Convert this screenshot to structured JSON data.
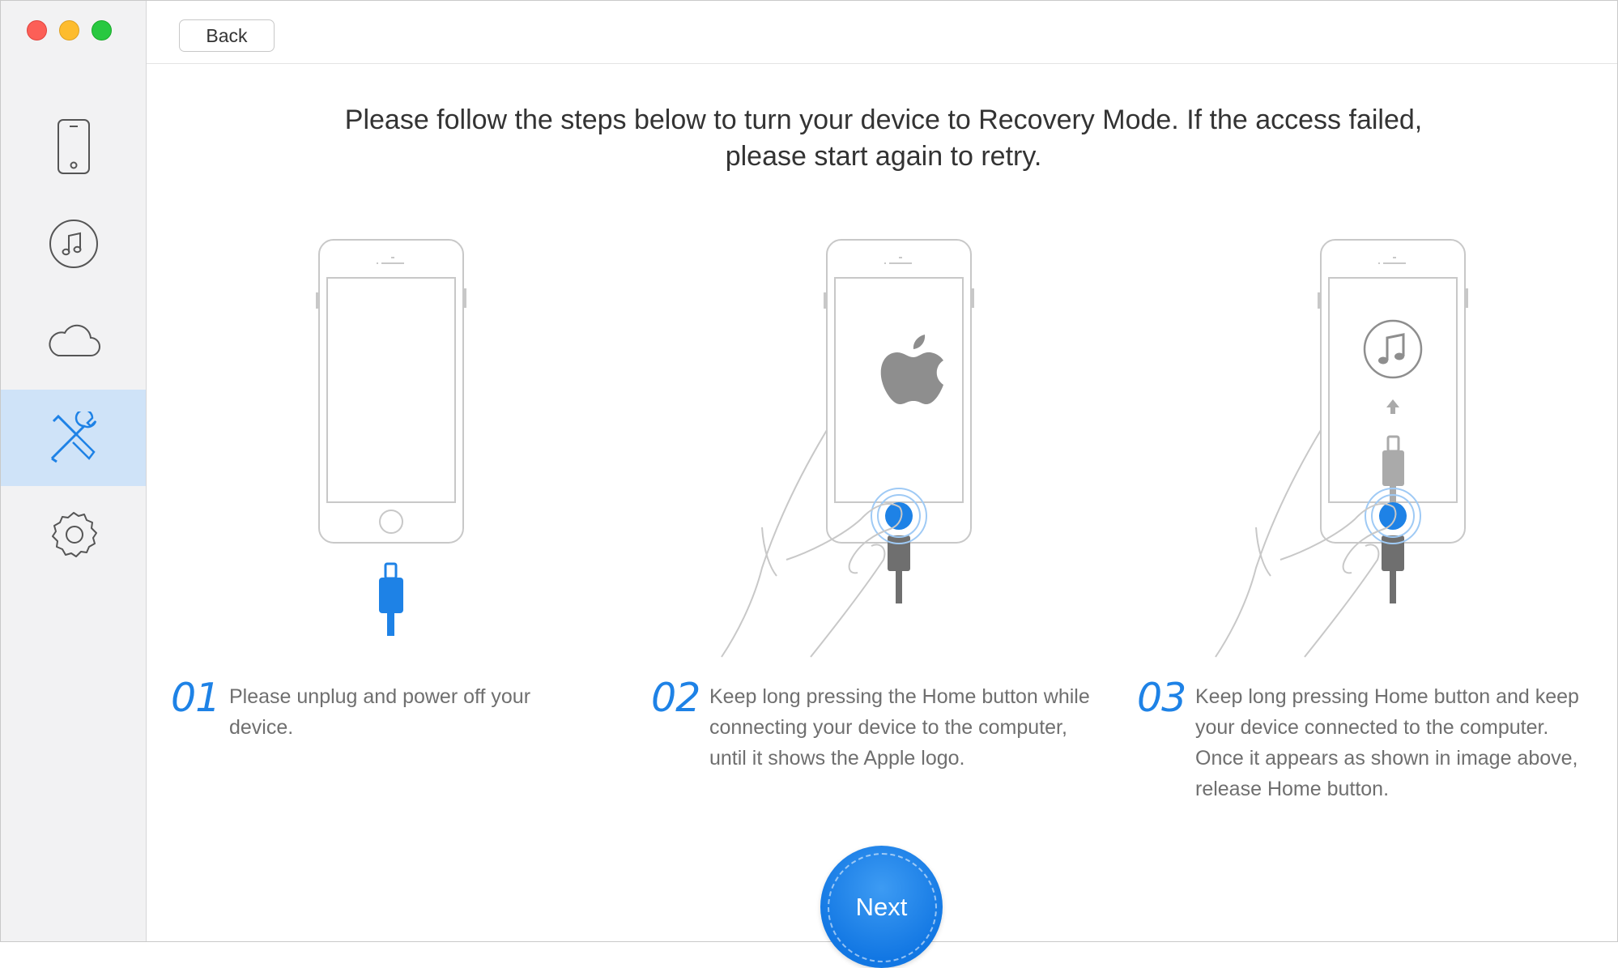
{
  "toolbar": {
    "back_label": "Back"
  },
  "sidebar": {
    "items": [
      {
        "icon": "iphone-icon",
        "active": false
      },
      {
        "icon": "music-icon",
        "active": false
      },
      {
        "icon": "cloud-icon",
        "active": false
      },
      {
        "icon": "tools-icon",
        "active": true
      },
      {
        "icon": "gear-icon",
        "active": false
      }
    ]
  },
  "main": {
    "headline": "Please follow the steps below to turn your device to Recovery Mode. If the access failed, please start again to retry.",
    "steps": [
      {
        "num": "01",
        "text": "Please unplug and power off your device."
      },
      {
        "num": "02",
        "text": "Keep long pressing the Home button while connecting your device to the computer, until it shows the Apple logo."
      },
      {
        "num": "03",
        "text": "Keep long pressing Home button and keep your device connected to the computer. Once it appears as shown in image above, release Home button."
      }
    ],
    "next_label": "Next"
  },
  "colors": {
    "accent": "#1e82e6",
    "sidebar_active": "#cfe3f8",
    "sidebar_bg": "#f2f2f3"
  }
}
